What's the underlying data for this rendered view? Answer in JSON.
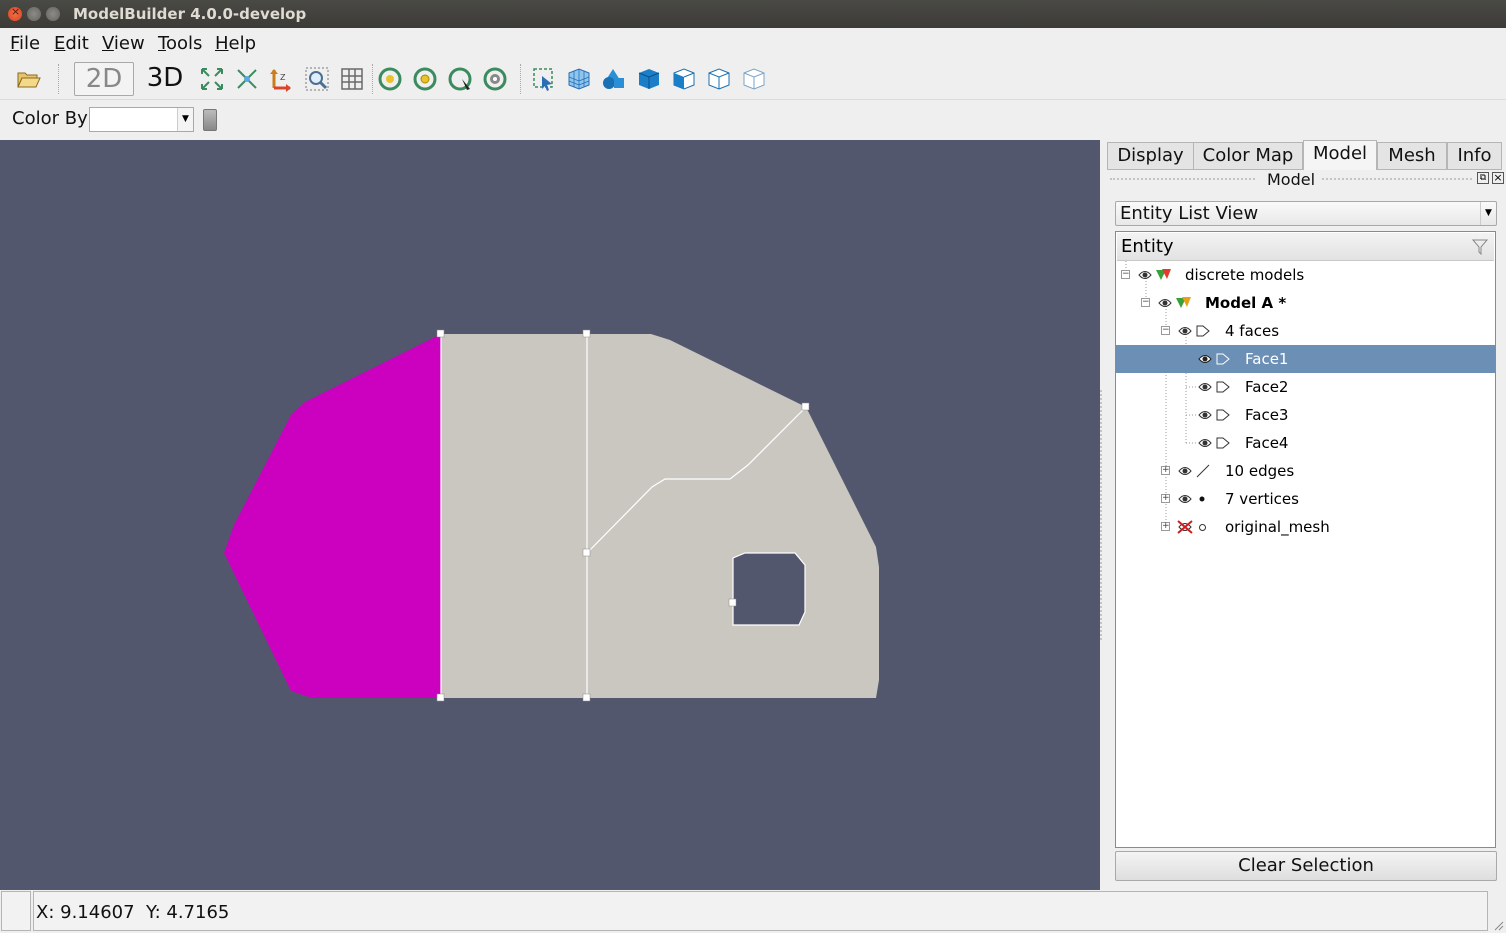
{
  "window": {
    "title": "ModelBuilder 4.0.0-develop"
  },
  "menu": [
    {
      "label": "File",
      "ul": "F",
      "rest": "ile"
    },
    {
      "label": "Edit",
      "ul": "E",
      "rest": "dit"
    },
    {
      "label": "View",
      "ul": "V",
      "rest": "iew"
    },
    {
      "label": "Tools",
      "ul": "T",
      "rest": "ools"
    },
    {
      "label": "Help",
      "ul": "H",
      "rest": "elp"
    }
  ],
  "toolbar": {
    "btn_2d": "2D",
    "btn_3d": "3D"
  },
  "colorby": {
    "label": "Color By",
    "value": ""
  },
  "panel": {
    "tabs": [
      "Display",
      "Color Map",
      "Model",
      "Mesh",
      "Info"
    ],
    "active_tab": "Model",
    "dock_title": "Model",
    "view_select": "Entity List View",
    "tree_header": "Entity",
    "tree": [
      {
        "label": "discrete models",
        "bold": false
      },
      {
        "label": "Model A *",
        "bold": true
      },
      {
        "label": "4 faces",
        "bold": false
      },
      {
        "label": "Face1",
        "bold": false,
        "selected": true
      },
      {
        "label": "Face2",
        "bold": false
      },
      {
        "label": "Face3",
        "bold": false
      },
      {
        "label": "Face4",
        "bold": false
      },
      {
        "label": "10 edges",
        "bold": false
      },
      {
        "label": "7 vertices",
        "bold": false
      },
      {
        "label": "original_mesh",
        "bold": false
      }
    ],
    "clear_button": "Clear Selection"
  },
  "status": {
    "coords": "X: 9.14607  Y: 4.7165"
  },
  "colors": {
    "viewport_bg": "#52576e",
    "face_selected": "#cc00bf",
    "face_default": "#c9c7c0",
    "selection_row": "#6b8fb5"
  }
}
